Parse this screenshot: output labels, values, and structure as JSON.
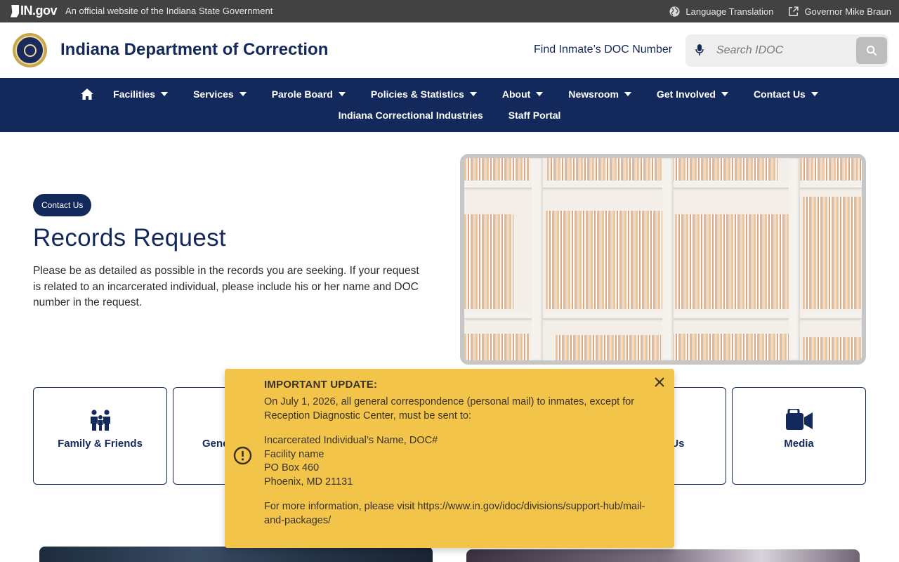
{
  "gov_bar": {
    "logo": "IN.gov",
    "tagline": "An official website of the Indiana State Government",
    "links": [
      {
        "label": "Language Translation",
        "icon": "globe-icon"
      },
      {
        "label": "Governor Mike Braun",
        "icon": "external-link-icon"
      }
    ]
  },
  "header": {
    "site_title": "Indiana Department of Correction",
    "find_inmate": "Find Inmate’s DOC Number",
    "search_placeholder": "Search IDOC"
  },
  "nav": {
    "row1": [
      {
        "label": "Facilities"
      },
      {
        "label": "Services"
      },
      {
        "label": "Parole Board"
      },
      {
        "label": "Policies & Statistics"
      },
      {
        "label": "About"
      },
      {
        "label": "Newsroom"
      },
      {
        "label": "Get Involved"
      },
      {
        "label": "Contact Us"
      }
    ],
    "row2": [
      {
        "label": "Indiana Correctional Industries"
      },
      {
        "label": "Staff Portal"
      }
    ]
  },
  "hero": {
    "chip": "Contact Us",
    "title": "Records Request",
    "description": "Please be as detailed as possible in the records you are seeking. If your request is related to an incarcerated individual, please include his or her name and DOC number in the request."
  },
  "cards": [
    {
      "label": "Family & Friends",
      "icon": "family-icon"
    },
    {
      "label": "Gene",
      "icon": ""
    },
    {
      "label": "n Us",
      "icon": ""
    },
    {
      "label": "Media",
      "icon": "video-camera-icon"
    }
  ],
  "alert": {
    "title": "IMPORTANT UPDATE:",
    "intro": "On July 1, 2026, all general correspondence (personal mail) to inmates, except for Reception Diagnostic Center, must be sent to:",
    "address": [
      "Incarcerated Individual’s Name, DOC#",
      "Facility name",
      "PO Box 460",
      "Phoenix, MD 21131"
    ],
    "more": "For more information, please visit https://www.in.gov/idoc/divisions/support-hub/mail-and-packages/"
  },
  "colors": {
    "navy": "#14295b",
    "gov_bar": "#424242",
    "alert": "#f2c54a"
  }
}
